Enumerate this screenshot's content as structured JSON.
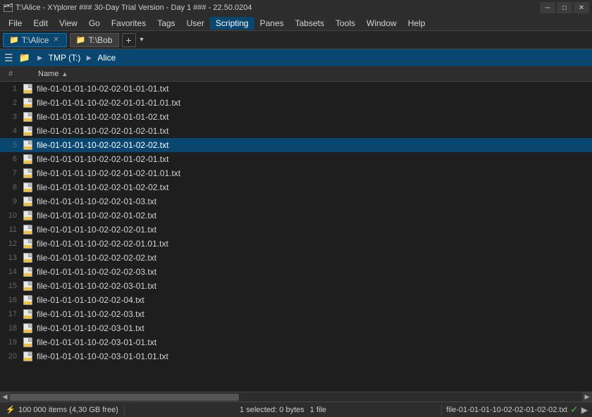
{
  "titleBar": {
    "text": "T:\\Alice - XYplorer ### 30-Day Trial Version - Day 1 ### - 22.50.0204",
    "icon": "🗂"
  },
  "menuBar": {
    "items": [
      "File",
      "Edit",
      "View",
      "Go",
      "Favorites",
      "Tags",
      "User",
      "Scripting",
      "Panes",
      "Tabsets",
      "Tools",
      "Window",
      "Help"
    ],
    "activeItem": "Scripting"
  },
  "tabs": [
    {
      "label": "T:\\Alice",
      "active": true
    },
    {
      "label": "T:\\Bob",
      "active": false
    }
  ],
  "breadcrumb": {
    "parts": [
      "TMP (T:)",
      "Alice"
    ]
  },
  "columnHeaders": {
    "num": "#",
    "name": "Name",
    "sortAsc": true
  },
  "files": [
    {
      "num": 1,
      "name": "file-01-01-01-10-02-02-01-01-01.txt",
      "selected": false
    },
    {
      "num": 2,
      "name": "file-01-01-01-10-02-02-01-01-01.01.txt",
      "selected": false
    },
    {
      "num": 3,
      "name": "file-01-01-01-10-02-02-01-01-02.txt",
      "selected": false
    },
    {
      "num": 4,
      "name": "file-01-01-01-10-02-02-01-02-01.txt",
      "selected": false
    },
    {
      "num": 5,
      "name": "file-01-01-01-10-02-02-01-02-02.txt",
      "selected": true
    },
    {
      "num": 6,
      "name": "file-01-01-01-10-02-02-01-02-01.txt",
      "selected": false
    },
    {
      "num": 7,
      "name": "file-01-01-01-10-02-02-01-02-01.01.txt",
      "selected": false
    },
    {
      "num": 8,
      "name": "file-01-01-01-10-02-02-01-02-02.txt",
      "selected": false
    },
    {
      "num": 9,
      "name": "file-01-01-01-10-02-02-01-03.txt",
      "selected": false
    },
    {
      "num": 10,
      "name": "file-01-01-01-10-02-02-01-02.txt",
      "selected": false
    },
    {
      "num": 11,
      "name": "file-01-01-01-10-02-02-02-01.txt",
      "selected": false
    },
    {
      "num": 12,
      "name": "file-01-01-01-10-02-02-02-01.01.txt",
      "selected": false
    },
    {
      "num": 13,
      "name": "file-01-01-01-10-02-02-02-02.txt",
      "selected": false
    },
    {
      "num": 14,
      "name": "file-01-01-01-10-02-02-02-03.txt",
      "selected": false
    },
    {
      "num": 15,
      "name": "file-01-01-01-10-02-02-03-01.txt",
      "selected": false
    },
    {
      "num": 16,
      "name": "file-01-01-01-10-02-02-04.txt",
      "selected": false
    },
    {
      "num": 17,
      "name": "file-01-01-01-10-02-02-03.txt",
      "selected": false
    },
    {
      "num": 18,
      "name": "file-01-01-01-10-02-03-01.txt",
      "selected": false
    },
    {
      "num": 19,
      "name": "file-01-01-01-10-02-03-01-01.txt",
      "selected": false
    },
    {
      "num": 20,
      "name": "file-01-01-01-10-02-03-01-01.01.txt",
      "selected": false
    }
  ],
  "statusBar": {
    "leftIcon": "⚡",
    "itemCount": "100 000 items (4,30 GB free)",
    "selection": "1 selected: 0 bytes",
    "fileCount": "1 file",
    "selectedFile": "file-01-01-01-10-02-02-01-02-02.txt"
  }
}
